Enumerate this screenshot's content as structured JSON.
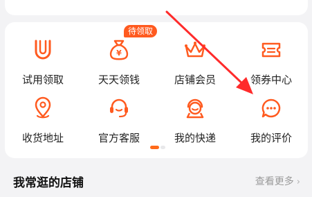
{
  "colors": {
    "accent": "#ff5a1f",
    "annotation": "#ff2b2b"
  },
  "grid": {
    "items": [
      {
        "label": "试用领取",
        "icon": "u-magnet-icon"
      },
      {
        "label": "天天领钱",
        "icon": "money-bag-icon",
        "badge": "待领取"
      },
      {
        "label": "店铺会员",
        "icon": "crown-icon"
      },
      {
        "label": "领券中心",
        "icon": "coupon-icon"
      },
      {
        "label": "收货地址",
        "icon": "location-pin-icon"
      },
      {
        "label": "官方客服",
        "icon": "headset-icon"
      },
      {
        "label": "我的快递",
        "icon": "courier-icon"
      },
      {
        "label": "我的评价",
        "icon": "chat-bubble-icon"
      }
    ]
  },
  "section": {
    "title": "我常逛的店铺",
    "more_label": "查看更多"
  }
}
